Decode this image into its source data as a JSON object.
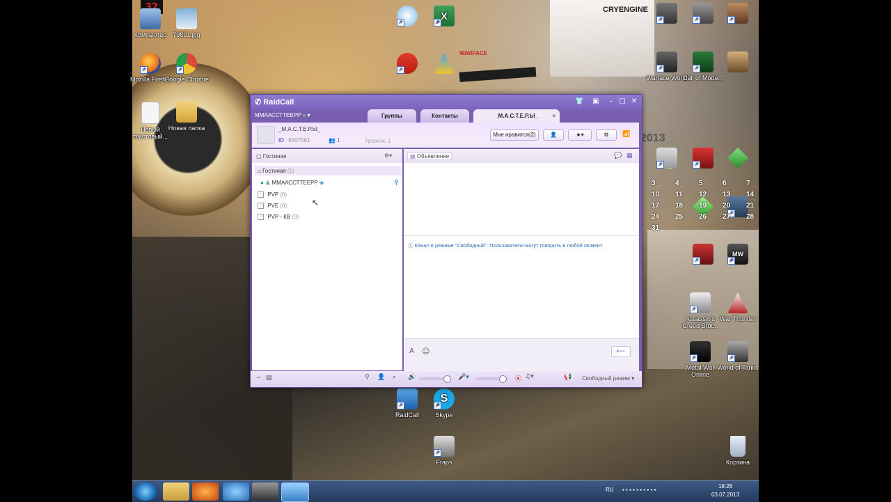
{
  "desktop": {
    "counter": "32",
    "icons": [
      {
        "label": "Компьютер",
        "icon": "computer-icon"
      },
      {
        "label": "79891.jpg",
        "icon": "image-file-icon"
      },
      {
        "label": "Mozilla Firefox",
        "icon": "firefox-icon"
      },
      {
        "label": "Google Chrome",
        "icon": "chrome-icon"
      },
      {
        "label": "Новый текстовый...",
        "icon": "text-file-icon"
      },
      {
        "label": "Новая папка",
        "icon": "folder-icon"
      },
      {
        "label": "RaidCall",
        "icon": "raidcall-icon"
      },
      {
        "label": "Skype",
        "icon": "skype-icon"
      },
      {
        "label": "Fraps",
        "icon": "fraps-icon"
      },
      {
        "label": "Metal War Online",
        "icon": "mwo-icon"
      },
      {
        "label": "World of Tanks",
        "icon": "wot-icon"
      },
      {
        "label": "Assassin's Creed Brot...",
        "icon": "assassins-creed-icon"
      },
      {
        "label": "War Thunder",
        "icon": "war-thunder-icon"
      },
      {
        "label": "Call of Mode...",
        "icon": "call-of-duty-icon"
      },
      {
        "label": "Warface World",
        "icon": "warface-icon"
      },
      {
        "label": "Корзина",
        "icon": "recycle-bin-icon"
      }
    ],
    "wallpaper_text": {
      "cryengine": "CRYENGINE",
      "warface": "WARFACE",
      "year": "2013",
      "thu": "ЧТ"
    },
    "calendar_numbers": [
      "3",
      "4",
      "5",
      "6",
      "7",
      "10",
      "11",
      "12",
      "13",
      "14",
      "17",
      "18",
      "19",
      "20",
      "21",
      "24",
      "25",
      "26",
      "27",
      "28",
      "31"
    ]
  },
  "raidcall": {
    "app_name": "RaidCall",
    "user_status_name": "ММААССТТЕЕРР",
    "tabs": [
      "Группы",
      "Контакты",
      "_М.А.С.Т.Е.Р.Ы_"
    ],
    "group": {
      "name": "_М.А.С.Т.Е.Р.Ы_",
      "id_label": "ID",
      "id": "6307561",
      "members": "1",
      "level_label": "Уровень",
      "level": "1"
    },
    "buttons": {
      "like": "Мне нравится(2)"
    },
    "left_panel": {
      "title": "Гостиная",
      "channels": [
        {
          "name": "Гостиная",
          "count": "(1)"
        },
        {
          "name": "ММААССТТЕЕРР",
          "count": ""
        },
        {
          "name": "PVP",
          "count": "(0)"
        },
        {
          "name": "PVE",
          "count": "(0)"
        },
        {
          "name": "PVP - КВ",
          "count": "(0)"
        }
      ]
    },
    "right_panel": {
      "announcement_title": "Объявление",
      "info_message": "Канал в режиме \"Свободный\". Пользователи могут говорить в любой момент.",
      "input_value": ""
    },
    "bottom": {
      "mode": "Свободный режим",
      "volume_level": 0.85,
      "mic_level": 0.8
    }
  },
  "taskbar": {
    "lang": "RU",
    "time": "18:28",
    "date": "03.07.2013",
    "items": [
      "start-orb",
      "explorer",
      "firefox",
      "download-master",
      "fraps",
      "raidcall"
    ]
  },
  "colors": {
    "accent": "#7a63bf",
    "window_bg": "#f0eaf8",
    "info": "#2a6fb0"
  }
}
